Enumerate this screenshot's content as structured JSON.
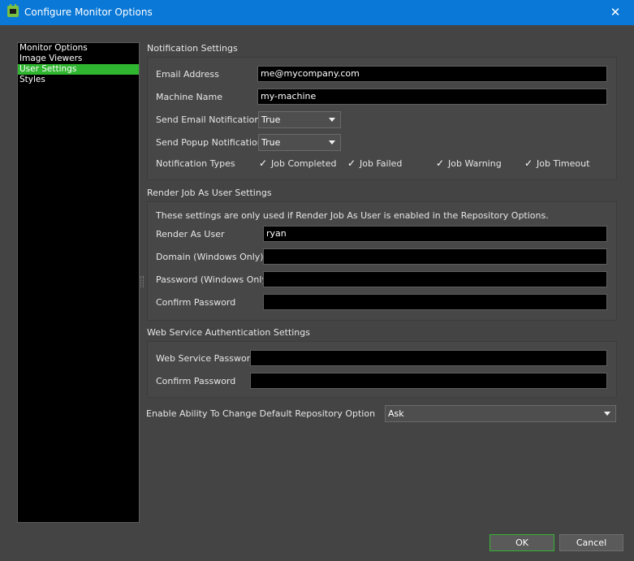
{
  "window": {
    "title": "Configure Monitor Options",
    "close_glyph": "✕",
    "icon": "deadline-monitor-icon"
  },
  "sidebar": {
    "items": [
      {
        "label": "Monitor Options",
        "selected": false
      },
      {
        "label": "Image Viewers",
        "selected": false
      },
      {
        "label": "User Settings",
        "selected": true
      },
      {
        "label": "Styles",
        "selected": false
      }
    ]
  },
  "notification": {
    "group_title": "Notification Settings",
    "email_label": "Email Address",
    "email_value": "me@mycompany.com",
    "machine_label": "Machine Name",
    "machine_value": "my-machine",
    "send_email_label": "Send Email Notifications",
    "send_email_value": "True",
    "send_popup_label": "Send Popup Notifications",
    "send_popup_value": "True",
    "types_label": "Notification Types",
    "types": [
      {
        "label": "Job Completed",
        "checked": true
      },
      {
        "label": "Job Failed",
        "checked": true
      },
      {
        "label": "Job Warning",
        "checked": true
      },
      {
        "label": "Job Timeout",
        "checked": true
      }
    ]
  },
  "render_as_user": {
    "group_title": "Render Job As User Settings",
    "note": "These settings are only used if Render Job As User is enabled in the Repository Options.",
    "user_label": "Render As User",
    "user_value": "ryan",
    "domain_label": "Domain (Windows Only)",
    "domain_value": "",
    "password_label": "Password (Windows Only)",
    "password_value": "",
    "confirm_label": "Confirm Password",
    "confirm_value": ""
  },
  "web_service": {
    "group_title": "Web Service Authentication Settings",
    "password_label": "Web Service Password",
    "password_value": "",
    "confirm_label": "Confirm Password",
    "confirm_value": ""
  },
  "repository_option": {
    "label": "Enable Ability To Change Default Repository Option",
    "value": "Ask"
  },
  "buttons": {
    "ok": "OK",
    "cancel": "Cancel"
  },
  "colors": {
    "titlebar": "#0a78d7",
    "selection": "#2fb52f",
    "background": "#444444"
  }
}
